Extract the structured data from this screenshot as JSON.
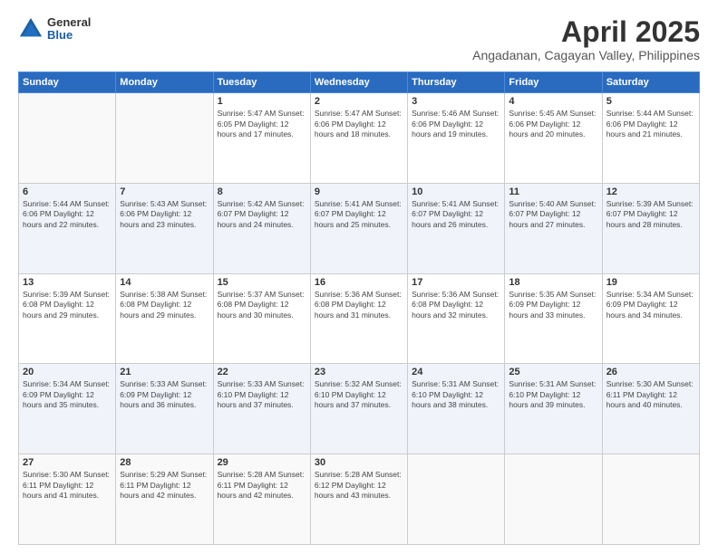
{
  "header": {
    "logo_general": "General",
    "logo_blue": "Blue",
    "month_title": "April 2025",
    "location": "Angadanan, Cagayan Valley, Philippines"
  },
  "days_of_week": [
    "Sunday",
    "Monday",
    "Tuesday",
    "Wednesday",
    "Thursday",
    "Friday",
    "Saturday"
  ],
  "weeks": [
    [
      {
        "day": "",
        "info": ""
      },
      {
        "day": "",
        "info": ""
      },
      {
        "day": "1",
        "info": "Sunrise: 5:47 AM\nSunset: 6:05 PM\nDaylight: 12 hours\nand 17 minutes."
      },
      {
        "day": "2",
        "info": "Sunrise: 5:47 AM\nSunset: 6:06 PM\nDaylight: 12 hours\nand 18 minutes."
      },
      {
        "day": "3",
        "info": "Sunrise: 5:46 AM\nSunset: 6:06 PM\nDaylight: 12 hours\nand 19 minutes."
      },
      {
        "day": "4",
        "info": "Sunrise: 5:45 AM\nSunset: 6:06 PM\nDaylight: 12 hours\nand 20 minutes."
      },
      {
        "day": "5",
        "info": "Sunrise: 5:44 AM\nSunset: 6:06 PM\nDaylight: 12 hours\nand 21 minutes."
      }
    ],
    [
      {
        "day": "6",
        "info": "Sunrise: 5:44 AM\nSunset: 6:06 PM\nDaylight: 12 hours\nand 22 minutes."
      },
      {
        "day": "7",
        "info": "Sunrise: 5:43 AM\nSunset: 6:06 PM\nDaylight: 12 hours\nand 23 minutes."
      },
      {
        "day": "8",
        "info": "Sunrise: 5:42 AM\nSunset: 6:07 PM\nDaylight: 12 hours\nand 24 minutes."
      },
      {
        "day": "9",
        "info": "Sunrise: 5:41 AM\nSunset: 6:07 PM\nDaylight: 12 hours\nand 25 minutes."
      },
      {
        "day": "10",
        "info": "Sunrise: 5:41 AM\nSunset: 6:07 PM\nDaylight: 12 hours\nand 26 minutes."
      },
      {
        "day": "11",
        "info": "Sunrise: 5:40 AM\nSunset: 6:07 PM\nDaylight: 12 hours\nand 27 minutes."
      },
      {
        "day": "12",
        "info": "Sunrise: 5:39 AM\nSunset: 6:07 PM\nDaylight: 12 hours\nand 28 minutes."
      }
    ],
    [
      {
        "day": "13",
        "info": "Sunrise: 5:39 AM\nSunset: 6:08 PM\nDaylight: 12 hours\nand 29 minutes."
      },
      {
        "day": "14",
        "info": "Sunrise: 5:38 AM\nSunset: 6:08 PM\nDaylight: 12 hours\nand 29 minutes."
      },
      {
        "day": "15",
        "info": "Sunrise: 5:37 AM\nSunset: 6:08 PM\nDaylight: 12 hours\nand 30 minutes."
      },
      {
        "day": "16",
        "info": "Sunrise: 5:36 AM\nSunset: 6:08 PM\nDaylight: 12 hours\nand 31 minutes."
      },
      {
        "day": "17",
        "info": "Sunrise: 5:36 AM\nSunset: 6:08 PM\nDaylight: 12 hours\nand 32 minutes."
      },
      {
        "day": "18",
        "info": "Sunrise: 5:35 AM\nSunset: 6:09 PM\nDaylight: 12 hours\nand 33 minutes."
      },
      {
        "day": "19",
        "info": "Sunrise: 5:34 AM\nSunset: 6:09 PM\nDaylight: 12 hours\nand 34 minutes."
      }
    ],
    [
      {
        "day": "20",
        "info": "Sunrise: 5:34 AM\nSunset: 6:09 PM\nDaylight: 12 hours\nand 35 minutes."
      },
      {
        "day": "21",
        "info": "Sunrise: 5:33 AM\nSunset: 6:09 PM\nDaylight: 12 hours\nand 36 minutes."
      },
      {
        "day": "22",
        "info": "Sunrise: 5:33 AM\nSunset: 6:10 PM\nDaylight: 12 hours\nand 37 minutes."
      },
      {
        "day": "23",
        "info": "Sunrise: 5:32 AM\nSunset: 6:10 PM\nDaylight: 12 hours\nand 37 minutes."
      },
      {
        "day": "24",
        "info": "Sunrise: 5:31 AM\nSunset: 6:10 PM\nDaylight: 12 hours\nand 38 minutes."
      },
      {
        "day": "25",
        "info": "Sunrise: 5:31 AM\nSunset: 6:10 PM\nDaylight: 12 hours\nand 39 minutes."
      },
      {
        "day": "26",
        "info": "Sunrise: 5:30 AM\nSunset: 6:11 PM\nDaylight: 12 hours\nand 40 minutes."
      }
    ],
    [
      {
        "day": "27",
        "info": "Sunrise: 5:30 AM\nSunset: 6:11 PM\nDaylight: 12 hours\nand 41 minutes."
      },
      {
        "day": "28",
        "info": "Sunrise: 5:29 AM\nSunset: 6:11 PM\nDaylight: 12 hours\nand 42 minutes."
      },
      {
        "day": "29",
        "info": "Sunrise: 5:28 AM\nSunset: 6:11 PM\nDaylight: 12 hours\nand 42 minutes."
      },
      {
        "day": "30",
        "info": "Sunrise: 5:28 AM\nSunset: 6:12 PM\nDaylight: 12 hours\nand 43 minutes."
      },
      {
        "day": "",
        "info": ""
      },
      {
        "day": "",
        "info": ""
      },
      {
        "day": "",
        "info": ""
      }
    ]
  ]
}
